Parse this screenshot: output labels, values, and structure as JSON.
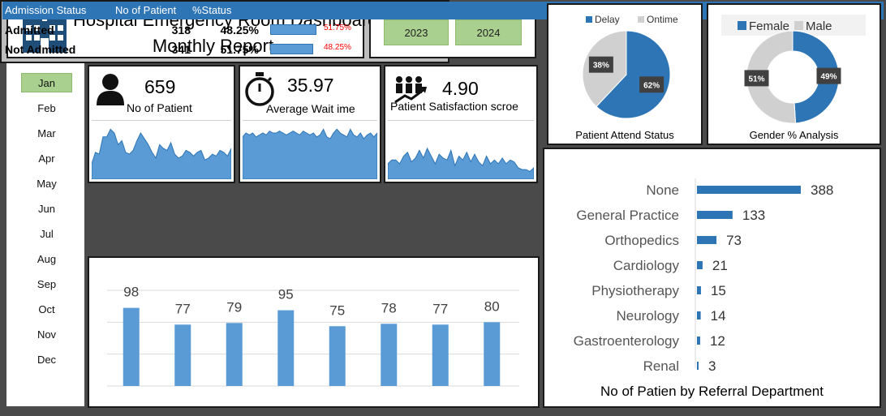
{
  "header": {
    "title_line1": "Hospital Emergency Room Dashboard",
    "title_line2": "Monthly Report",
    "years": [
      "2023",
      "2024"
    ]
  },
  "months": [
    "Jan",
    "Feb",
    "Mar",
    "Apr",
    "May",
    "Jun",
    "Jul",
    "Aug",
    "Sep",
    "Oct",
    "Nov",
    "Dec"
  ],
  "selected_month": "Jan",
  "kpis": {
    "patients": {
      "value": "659",
      "label": "No of Patient",
      "icon": "person-icon"
    },
    "wait": {
      "value": "35.97",
      "label": "Average Wait ime",
      "icon": "stopwatch-icon"
    },
    "satisfaction": {
      "value": "4.90",
      "label": "Patient Satisfaction scroe",
      "icon": "growth-people-icon"
    }
  },
  "admission": {
    "headers": [
      "Admission Status",
      "No of Patient",
      "%Status"
    ],
    "rows": [
      {
        "status": "Admitted",
        "count": "318",
        "pct": "48.25%",
        "bar_pct": "51.75%",
        "bar_fraction": 0.5175
      },
      {
        "status": "Not Admitted",
        "count": "341",
        "pct": "51.75%",
        "bar_pct": "48.25%",
        "bar_fraction": 0.4825
      }
    ]
  },
  "colors": {
    "accent": "#2e75b6",
    "bar": "#5b9bd5",
    "light_gray": "#d0d0d0",
    "year_button": "#a9d08e",
    "pct_red": "#ff0000"
  },
  "chart_data": [
    {
      "type": "area",
      "series": [
        {
          "values": [
            8,
            14,
            13,
            22,
            22,
            26,
            24,
            18,
            20,
            14,
            13,
            15,
            20,
            24,
            21,
            18,
            14,
            11,
            18,
            16,
            15,
            19,
            13,
            11,
            12,
            15,
            14,
            12,
            14,
            15,
            10,
            11,
            13,
            12,
            15,
            14,
            12,
            16
          ]
        }
      ]
    },
    {
      "type": "area",
      "series": [
        {
          "values": [
            22,
            24,
            23,
            24,
            22,
            23,
            24,
            23,
            25,
            24,
            24,
            25,
            24,
            23,
            24,
            25,
            24,
            23,
            25,
            24,
            23,
            24,
            22,
            23,
            26,
            22,
            21,
            24,
            26,
            24,
            23,
            22,
            26,
            23,
            22,
            24,
            21,
            23,
            24,
            22,
            24
          ]
        }
      ]
    },
    {
      "type": "area",
      "series": [
        {
          "values": [
            8,
            10,
            10,
            8,
            12,
            14,
            9,
            11,
            15,
            11,
            16,
            12,
            8,
            13,
            11,
            10,
            15,
            7,
            12,
            10,
            14,
            9,
            13,
            9,
            7,
            12,
            8,
            10,
            8,
            11,
            8,
            10,
            9,
            6,
            5,
            5,
            4,
            6
          ]
        }
      ]
    },
    {
      "type": "bar",
      "values": [
        98,
        77,
        79,
        95,
        75,
        78,
        77,
        80
      ],
      "ylim": [
        0,
        120
      ],
      "grid": true
    },
    {
      "type": "pie",
      "title": "Patient Attend Status",
      "legend": "top",
      "slices": [
        {
          "name": "Delay",
          "value": 62,
          "label": "62%",
          "color": "#2e75b6"
        },
        {
          "name": "Ontime",
          "value": 38,
          "label": "38%",
          "color": "#d0d0d0"
        }
      ]
    },
    {
      "type": "pie",
      "title": "Gender % Analysis",
      "legend": "top",
      "donut": true,
      "slices": [
        {
          "name": "Female",
          "value": 49,
          "label": "49%",
          "color": "#2e75b6"
        },
        {
          "name": "Male",
          "value": 51,
          "label": "51%",
          "color": "#d0d0d0"
        }
      ]
    },
    {
      "type": "bar",
      "orientation": "horizontal",
      "title": "No of Patien by Referral Department",
      "categories": [
        "None",
        "General Practice",
        "Orthopedics",
        "Cardiology",
        "Physiotherapy",
        "Neurology",
        "Gastroenterology",
        "Renal"
      ],
      "values": [
        388,
        133,
        73,
        21,
        15,
        14,
        12,
        3
      ]
    }
  ]
}
